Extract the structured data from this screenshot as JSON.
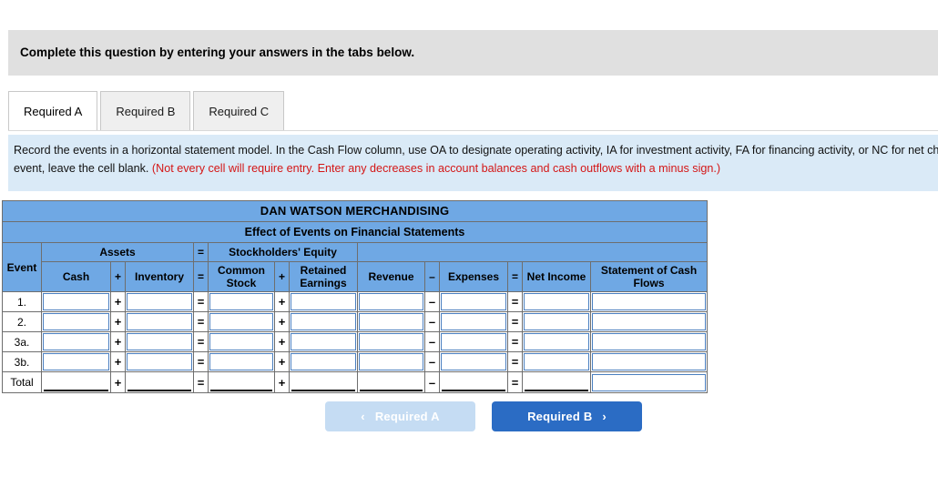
{
  "banner": {
    "text": "Complete this question by entering your answers in the tabs below."
  },
  "tabs": [
    {
      "label": "Required A",
      "active": true
    },
    {
      "label": "Required B",
      "active": false
    },
    {
      "label": "Required C",
      "active": false
    }
  ],
  "instructions": {
    "normal_text": "Record the events in a horizontal statement model. In the Cash Flow column, use OA to designate operating activity, IA for investment activity, FA for financing activity, or NC for net change in cash. If the element is not affected by the event, leave the cell blank. ",
    "warning_text": "(Not every cell will require entry. Enter any decreases in account balances and cash outflows with a minus sign.)"
  },
  "table": {
    "company_title": "DAN WATSON MERCHANDISING",
    "subtitle": "Effect of Events on Financial Statements",
    "group_headers": {
      "assets": "Assets",
      "eq_sign_1": "=",
      "stockholders_equity": "Stockholders' Equity"
    },
    "column_headers": {
      "event": "Event",
      "cash": "Cash",
      "plus_1": "+",
      "inventory": "Inventory",
      "equals_1": "=",
      "common_stock": "Common Stock",
      "plus_2": "+",
      "retained_earnings": "Retained Earnings",
      "revenue": "Revenue",
      "minus_1": "–",
      "expenses": "Expenses",
      "equals_2": "=",
      "net_income": "Net Income",
      "statement_of_cash_flows": "Statement of Cash Flows"
    },
    "rows": [
      {
        "event": "1."
      },
      {
        "event": "2."
      },
      {
        "event": "3a."
      },
      {
        "event": "3b."
      }
    ],
    "total_row": {
      "event": "Total"
    },
    "cell_value": "",
    "header_color": "#6fa8e4",
    "input_border_color": "#4a7fc0"
  },
  "navigation": {
    "prev_label": "Required A",
    "next_label": "Required B",
    "prev_chevron": "‹",
    "next_chevron": "›",
    "prev_color": "#c5dcf3",
    "next_color": "#2b6cc4"
  }
}
